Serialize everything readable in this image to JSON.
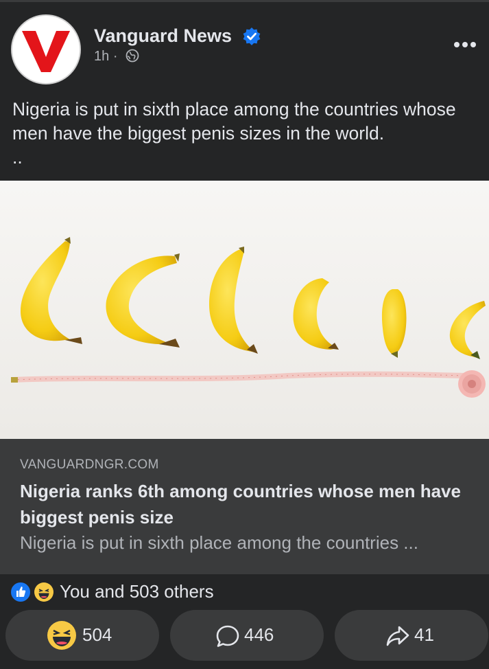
{
  "post": {
    "page_name": "Vanguard News",
    "time": "1h",
    "separator": "·",
    "text": "Nigeria is put in sixth place among the countries whose men have the biggest penis sizes in the world.",
    "text_more": ".."
  },
  "link": {
    "domain": "VANGUARDNGR.COM",
    "title": "Nigeria ranks 6th among countries whose men have biggest penis size",
    "description": "Nigeria is put in sixth place among the countries ..."
  },
  "reactions": {
    "summary": "You and 503 others",
    "icons": [
      "like-icon",
      "haha-icon"
    ]
  },
  "actions": {
    "reactions_count": "504",
    "comments_count": "446",
    "shares_count": "41"
  },
  "colors": {
    "background": "#242526",
    "card": "#3a3b3c",
    "text": "#e4e6eb",
    "secondary": "#b0b3b8",
    "verified": "#1877f2",
    "logo_red": "#e3151a"
  }
}
